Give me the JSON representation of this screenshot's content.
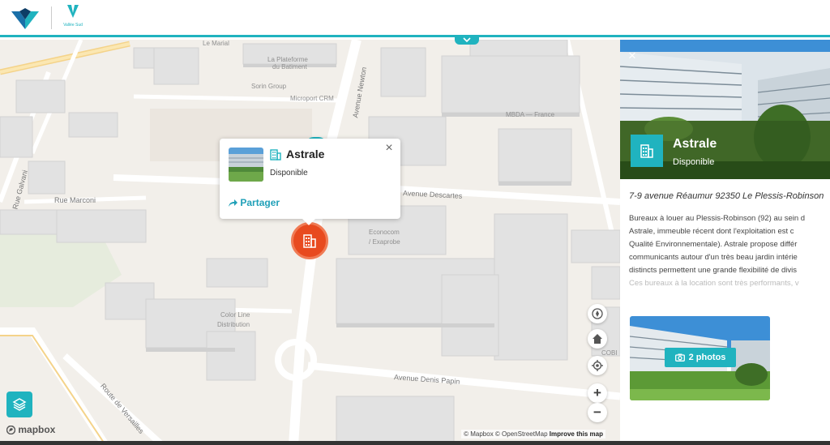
{
  "header": {
    "brand_logo_icon": "vallee-sud-emblem-icon",
    "partner_logo_text": "Vallée Sud",
    "collapse_icon": "chevron-down-icon"
  },
  "map": {
    "labels": {
      "le_marial": "Le Marial",
      "plateforme": "La Plateforme",
      "plateforme2": "du Batiment",
      "sorin": "Sorin Group",
      "microport": "Microport CRM",
      "mbda": "MBDA — France",
      "econocom": "Econocom",
      "exaprobe": "/ Exaprobe",
      "color_line": "Color Line",
      "distribution": "Distribution",
      "cobi": "COBI",
      "rue_marconi": "Rue Marconi",
      "avenue_descartes": "Avenue Descartes",
      "avenue_denis_papin": "Avenue Denis Papin",
      "route_versailles": "Route de Versailles",
      "avenue_newton": "Avenue Newton",
      "rue_galvani": "Rue Galvani"
    },
    "mapbox_logo": "mapbox",
    "attribution": {
      "mapbox": "© Mapbox",
      "osm": "© OpenStreetMap",
      "improve": "Improve this map"
    },
    "controls": {
      "compass": "compass-icon",
      "home": "home-icon",
      "locate": "locate-icon",
      "zoom_in": "+",
      "zoom_out": "−",
      "layers": "layers-icon"
    }
  },
  "popup": {
    "title": "Astrale",
    "status": "Disponible",
    "share_label": "Partager",
    "close": "×"
  },
  "panel": {
    "close": "×",
    "title": "Astrale",
    "status": "Disponible",
    "address": "7-9 avenue Réaumur 92350 Le Plessis-Robinson",
    "description_lines": [
      "Bureaux à louer au Plessis-Robinson (92) au sein d",
      "Astrale, immeuble récent dont l'exploitation est c",
      "Qualité Environnementale). Astrale propose différ",
      "communicants autour d'un très beau jardin intérie",
      "distincts permettent une grande flexibilité de divis"
    ],
    "description_faded": "Ces bureaux à la location sont très performants, v",
    "photos_label": "2 photos"
  },
  "colors": {
    "accent": "#20b3bf",
    "marker": "#e84a1f",
    "share": "#20a0b8"
  }
}
